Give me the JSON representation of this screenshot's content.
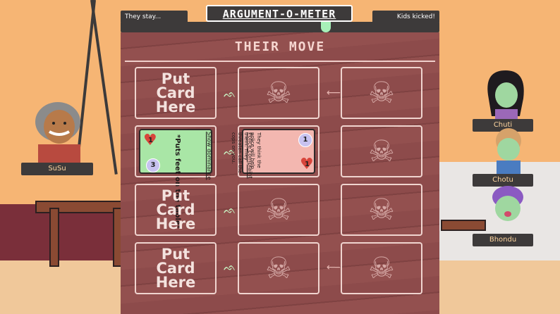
{
  "meter": {
    "title": "ARGUMENT-O-METER",
    "left_label": "They stay...",
    "right_label": "Kids kicked!",
    "accent": "#a7f0b8"
  },
  "board": {
    "title": "THEIR MOVE",
    "put_card_text": "Put Card Here",
    "rows": [
      {
        "left": "put",
        "middle": "skull",
        "right": "skull"
      },
      {
        "left": "card",
        "middle": "card",
        "right": "skull"
      },
      {
        "left": "put",
        "middle": "skull",
        "right": "skull"
      },
      {
        "left": "put",
        "middle": "skull",
        "right": "skull"
      }
    ],
    "cards": {
      "green": {
        "name": "Show dominance",
        "text": "*Puts feet on the table*",
        "heart_value": "1",
        "circle_value": "3"
      },
      "pink": {
        "name": "Police complaint",
        "text": "They think the police will help them. They threaten call the cops on you.",
        "heart_value": "1",
        "circle_value": "1"
      }
    }
  },
  "characters": {
    "susu": "SuSu",
    "chuti": "Chuti",
    "chotu": "Chotu",
    "bhondu": "Bhondu"
  },
  "icons": {
    "skull": "skull-crossbones-icon",
    "arrow": "arrow-left-icon",
    "butterfly": "butterfly-icon"
  }
}
